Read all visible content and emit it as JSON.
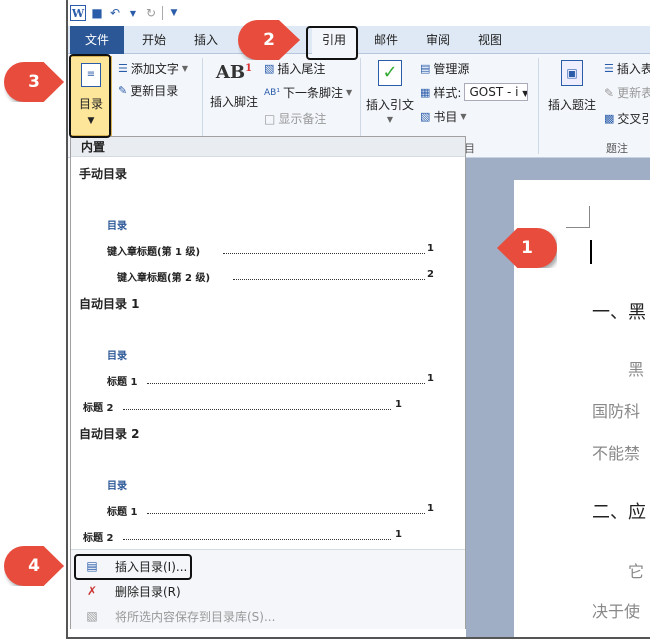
{
  "qat": {
    "app_icon": "W",
    "save_icon": "save-icon",
    "undo_icon": "undo-icon",
    "redo_icon": "redo-icon"
  },
  "tabs": [
    "文件",
    "开始",
    "插入",
    "引用",
    "邮件",
    "审阅",
    "视图"
  ],
  "ribbon": {
    "toc_label": "目录",
    "add_text": "添加文字",
    "update_toc": "更新目录",
    "footnote_big": "AB",
    "footnote_sup": "1",
    "insert_footnote": "插入脚注",
    "insert_endnote": "插入尾注",
    "next_footnote": "下一条脚注",
    "show_notes": "显示备注",
    "insert_citation": "插入引文",
    "manage_sources": "管理源",
    "style_label": "样式:",
    "style_value": "GOST - i",
    "bibliography": "书目",
    "group_citation_suffix": "目",
    "insert_caption": "插入题注",
    "insert_table_cut": "插入表",
    "update_table_cut": "更新表",
    "crossref_cut": "交叉引",
    "group_caption": "题注"
  },
  "dropdown": {
    "header": "内置",
    "manual_title": "手动目录",
    "auto1_title": "自动目录 1",
    "auto2_title": "自动目录 2",
    "toc_word": "目录",
    "manual_h1": "键入章标题(第 1 级)",
    "manual_h2": "键入章标题(第 2 级)",
    "heading1": "标题 1",
    "heading2": "标题 2",
    "page1": "1",
    "page2": "2",
    "insert_toc": "插入目录(I)...",
    "remove_toc": "删除目录(R)",
    "save_selection": "将所选内容保存到目录库(S)..."
  },
  "document": {
    "heading1": "一、黑",
    "para1": "黑",
    "para2": "国防科",
    "para3": "不能禁",
    "heading2": "二、应",
    "para4": "它",
    "para5": "决于使"
  },
  "callouts": [
    "1",
    "2",
    "3",
    "4"
  ],
  "colors": {
    "callout": "#e74c3c",
    "file_tab": "#2b5797",
    "toc_highlight": "#fde69a"
  }
}
